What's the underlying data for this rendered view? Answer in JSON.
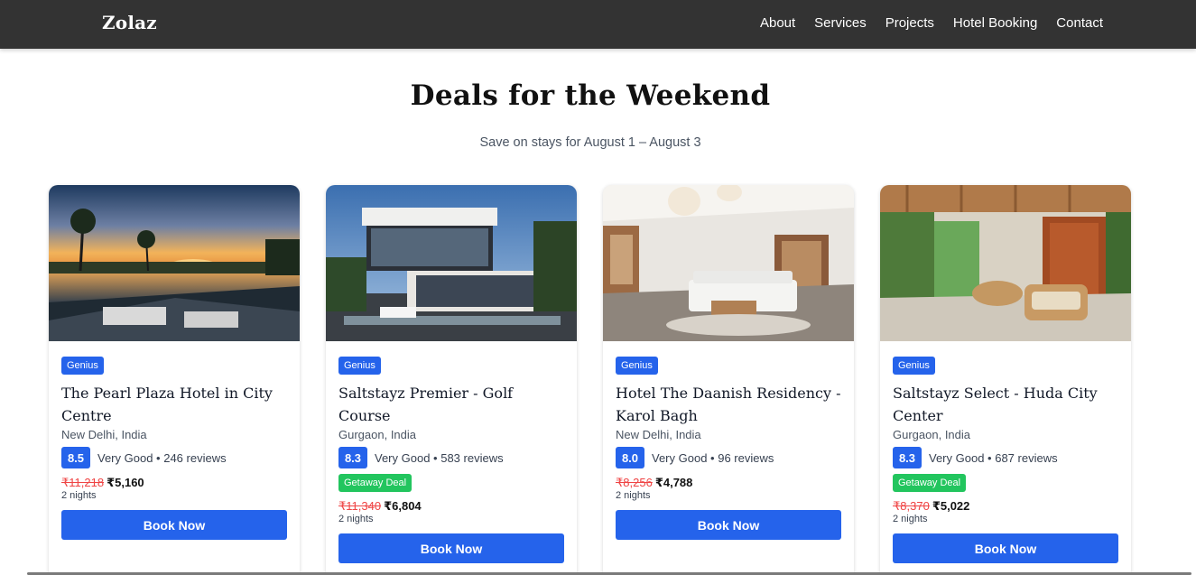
{
  "nav": {
    "brand": "Zolaz",
    "links": [
      "About",
      "Services",
      "Projects",
      "Hotel Booking",
      "Contact"
    ]
  },
  "section": {
    "title": "Deals for the Weekend",
    "subtitle": "Save on stays for August 1 – August 3"
  },
  "cards": [
    {
      "badge": "Genius",
      "name": "The Pearl Plaza Hotel in City Centre",
      "location": "New Delhi, India",
      "score": "8.5",
      "rating_label": "Very Good",
      "reviews": "246 reviews",
      "deal_badge": "",
      "old_price": "₹11,218",
      "new_price": "₹5,160",
      "nights": "2 nights",
      "button": "Book Now",
      "image_icon": "sunset-pool-photo"
    },
    {
      "badge": "Genius",
      "name": "Saltstayz Premier - Golf Course",
      "location": "Gurgaon, India",
      "score": "8.3",
      "rating_label": "Very Good",
      "reviews": "583 reviews",
      "deal_badge": "Getaway Deal",
      "old_price": "₹11,340",
      "new_price": "₹6,804",
      "nights": "2 nights",
      "button": "Book Now",
      "image_icon": "modern-villa-photo"
    },
    {
      "badge": "Genius",
      "name": "Hotel The Daanish Residency - Karol Bagh",
      "location": "New Delhi, India",
      "score": "8.0",
      "rating_label": "Very Good",
      "reviews": "96 reviews",
      "deal_badge": "",
      "old_price": "₹8,256",
      "new_price": "₹4,788",
      "nights": "2 nights",
      "button": "Book Now",
      "image_icon": "living-room-photo"
    },
    {
      "badge": "Genius",
      "name": "Saltstayz Select - Huda City Center",
      "location": "Gurgaon, India",
      "score": "8.3",
      "rating_label": "Very Good",
      "reviews": "687 reviews",
      "deal_badge": "Getaway Deal",
      "old_price": "₹8,370",
      "new_price": "₹5,022",
      "nights": "2 nights",
      "button": "Book Now",
      "image_icon": "patio-wicker-photo"
    }
  ],
  "colors": {
    "navbar": "#333333",
    "accent": "#2563eb",
    "deal": "#22c55e",
    "old_price": "#ef4444"
  }
}
